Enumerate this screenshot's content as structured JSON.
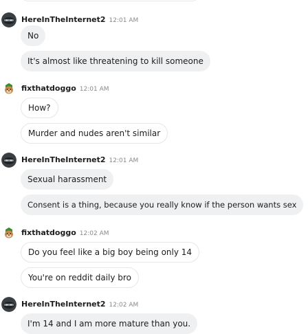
{
  "colors": {
    "grey_bubble": "#eef0f2",
    "white_bubble_border": "#e4e6e8",
    "timestamp": "#878a8c",
    "text": "#1c1c1c"
  },
  "icons": {
    "user_a": "reddit-snoo-avatar-dark",
    "user_b": "dog-avatar-green"
  },
  "messages": [
    {
      "user": "HereInTheInternet2",
      "time": "12:01 AM",
      "lines": [
        "No",
        "It's almost like threatening to kill someone"
      ]
    },
    {
      "user": "fixthatdoggo",
      "time": "12:01 AM",
      "lines": [
        "How?",
        "Murder and nudes aren't similar"
      ]
    },
    {
      "user": "HereInTheInternet2",
      "time": "12:01 AM",
      "lines": [
        "Sexual harassment",
        "Consent is a thing, because you really know if the person wants sex"
      ]
    },
    {
      "user": "fixthatdoggo",
      "time": "12:02 AM",
      "lines": [
        "Do you feel like a big boy being only 14",
        "You're on reddit daily bro"
      ]
    },
    {
      "user": "HereInTheInternet2",
      "time": "12:02 AM",
      "lines": [
        "I'm 14 and I am more mature than you."
      ]
    }
  ]
}
